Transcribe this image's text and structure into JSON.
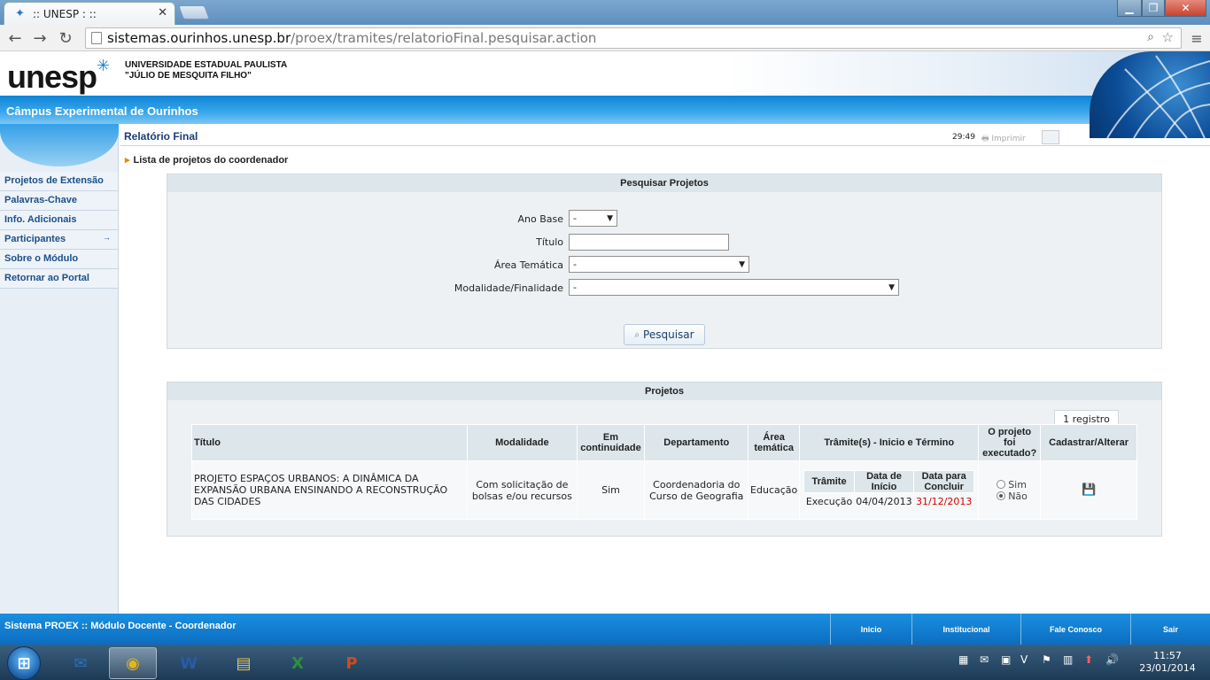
{
  "browser": {
    "tab_title": ":: UNESP : ::",
    "url_host": "sistemas.ourinhos.unesp.br",
    "url_path": "/proex/tramites/relatorioFinal.pesquisar.action"
  },
  "header": {
    "logo_text": "unesp",
    "university_line1": "UNIVERSIDADE ESTADUAL PAULISTA",
    "university_line2": "\"JÚLIO DE MESQUITA FILHO\"",
    "campus": "Câmpus Experimental de Ourinhos"
  },
  "sidebar": {
    "items": [
      {
        "label": "Projetos de Extensão"
      },
      {
        "label": "Palavras-Chave"
      },
      {
        "label": "Info. Adicionais"
      },
      {
        "label": "Participantes"
      },
      {
        "label": "Sobre o Módulo"
      },
      {
        "label": "Retornar ao Portal"
      }
    ]
  },
  "page": {
    "title": "Relatório Final",
    "timer": "29:49",
    "print_label": "Imprimir",
    "breadcrumb": "Lista de projetos do coordenador"
  },
  "search": {
    "panel_title": "Pesquisar Projetos",
    "ano_base_label": "Ano Base",
    "ano_base_value": "-",
    "titulo_label": "Título",
    "titulo_value": "",
    "area_label": "Área Temática",
    "area_value": "-",
    "modalidade_label": "Modalidade/Finalidade",
    "modalidade_value": "-",
    "button_label": "Pesquisar"
  },
  "projects": {
    "panel_title": "Projetos",
    "count": "1 registro",
    "columns": [
      "Título",
      "Modalidade",
      "Em continuidade",
      "Departamento",
      "Área temática",
      "Trâmite(s) - Inicio e Término",
      "O projeto foi executado?",
      "Cadastrar/Alterar"
    ],
    "sub_columns": [
      "Trâmite",
      "Data de Início",
      "Data para Concluir"
    ],
    "rows": [
      {
        "titulo": "PROJETO ESPAÇOS URBANOS: A DINÂMICA DA EXPANSÃO URBANA ENSINANDO A RECONSTRUÇÃO DAS CIDADES",
        "modalidade": "Com solicitação de bolsas e/ou recursos",
        "continuidade": "Sim",
        "departamento": "Coordenadoria do Curso de Geografia",
        "area": "Educação",
        "tramite": "Execução",
        "inicio": "04/04/2013",
        "concluir": "31/12/2013",
        "opt_sim": "Sim",
        "opt_nao": "Não",
        "executado": "Não"
      }
    ]
  },
  "footer": {
    "system_text": "Sistema PROEX :: Módulo Docente - Coordenador",
    "nav": [
      "Inicio",
      "Institucional",
      "Fale Conosco",
      "Sair"
    ]
  },
  "taskbar": {
    "time": "11:57",
    "date": "23/01/2014"
  },
  "colors": {
    "brand_blue": "#0f83d6",
    "link_blue": "#1c4f8a",
    "due_date_red": "#d00000"
  }
}
